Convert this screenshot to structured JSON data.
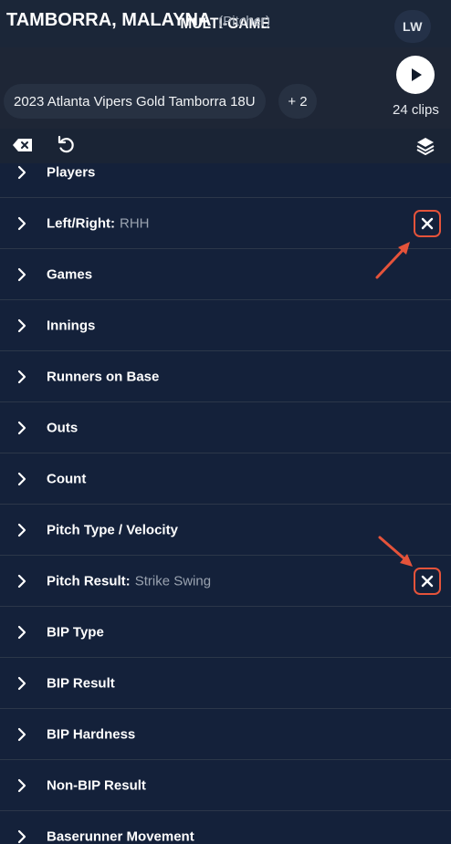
{
  "header": {
    "title": "MULTI-GAME",
    "avatar_initials": "LW"
  },
  "player": {
    "name": "TAMBORRA, MALAYNA",
    "role": "(Pitcher)",
    "team": "2023 Atlanta Vipers Gold Tamborra 18U",
    "extra_teams": "+ 2",
    "clips_label": "24 clips"
  },
  "toolbar": {
    "clear_icon": "backspace-icon",
    "reset_icon": "undo-icon",
    "layers_icon": "layers-icon"
  },
  "filters": [
    {
      "label": "Players",
      "value": ""
    },
    {
      "label": "Left/Right:",
      "value": "RHH",
      "clearable": true
    },
    {
      "label": "Games",
      "value": ""
    },
    {
      "label": "Innings",
      "value": ""
    },
    {
      "label": "Runners on Base",
      "value": ""
    },
    {
      "label": "Outs",
      "value": ""
    },
    {
      "label": "Count",
      "value": ""
    },
    {
      "label": "Pitch Type / Velocity",
      "value": ""
    },
    {
      "label": "Pitch Result:",
      "value": "Strike Swing",
      "clearable": true
    },
    {
      "label": "BIP Type",
      "value": ""
    },
    {
      "label": "BIP Result",
      "value": ""
    },
    {
      "label": "BIP Hardness",
      "value": ""
    },
    {
      "label": "Non-BIP Result",
      "value": ""
    },
    {
      "label": "Baserunner Movement",
      "value": ""
    }
  ],
  "colors": {
    "background": "#14213a",
    "annotation": "#e5533a"
  }
}
